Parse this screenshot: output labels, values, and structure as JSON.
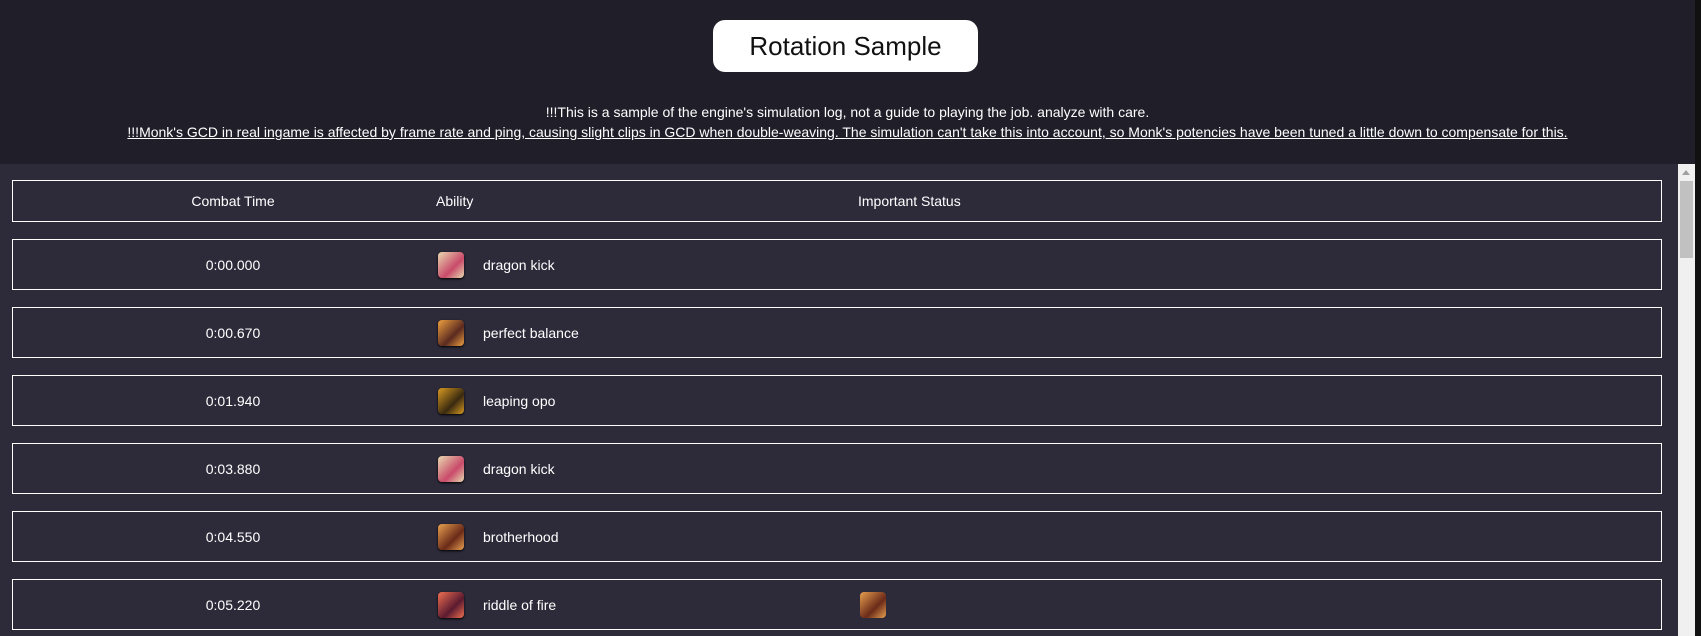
{
  "title": "Rotation Sample",
  "notes": [
    "!!!This is a sample of the engine's simulation log, not a guide to playing the job. analyze with care.",
    "!!!Monk's GCD in real ingame is affected by frame rate and ping, causing slight clips in GCD when double-weaving. The simulation can't take this into account, so Monk's potencies have been tuned a little down to compensate for this."
  ],
  "columns": [
    "Combat Time",
    "Ability",
    "Important Status"
  ],
  "rows": [
    {
      "time": "0:00.000",
      "ability": "dragon kick",
      "icon": "dragon-kick-icon",
      "colors": [
        "#e8d9b0",
        "#c94a6a"
      ],
      "status": []
    },
    {
      "time": "0:00.670",
      "ability": "perfect balance",
      "icon": "perfect-balance-icon",
      "colors": [
        "#f0a040",
        "#5a2a20"
      ],
      "status": []
    },
    {
      "time": "0:01.940",
      "ability": "leaping opo",
      "icon": "leaping-opo-icon",
      "colors": [
        "#d89a20",
        "#3a2a10"
      ],
      "status": []
    },
    {
      "time": "0:03.880",
      "ability": "dragon kick",
      "icon": "dragon-kick-icon",
      "colors": [
        "#e8d9b0",
        "#c94a6a"
      ],
      "status": []
    },
    {
      "time": "0:04.550",
      "ability": "brotherhood",
      "icon": "brotherhood-icon",
      "colors": [
        "#e8a050",
        "#6a2a18"
      ],
      "status": []
    },
    {
      "time": "0:05.220",
      "ability": "riddle of fire",
      "icon": "riddle-of-fire-icon",
      "colors": [
        "#f07050",
        "#5a1a30"
      ],
      "status": [
        "brotherhood-status-icon"
      ]
    }
  ],
  "colors": {
    "header_bg": "#1f1e29",
    "content_bg": "#2d2b3a",
    "border": "#ffffff"
  }
}
